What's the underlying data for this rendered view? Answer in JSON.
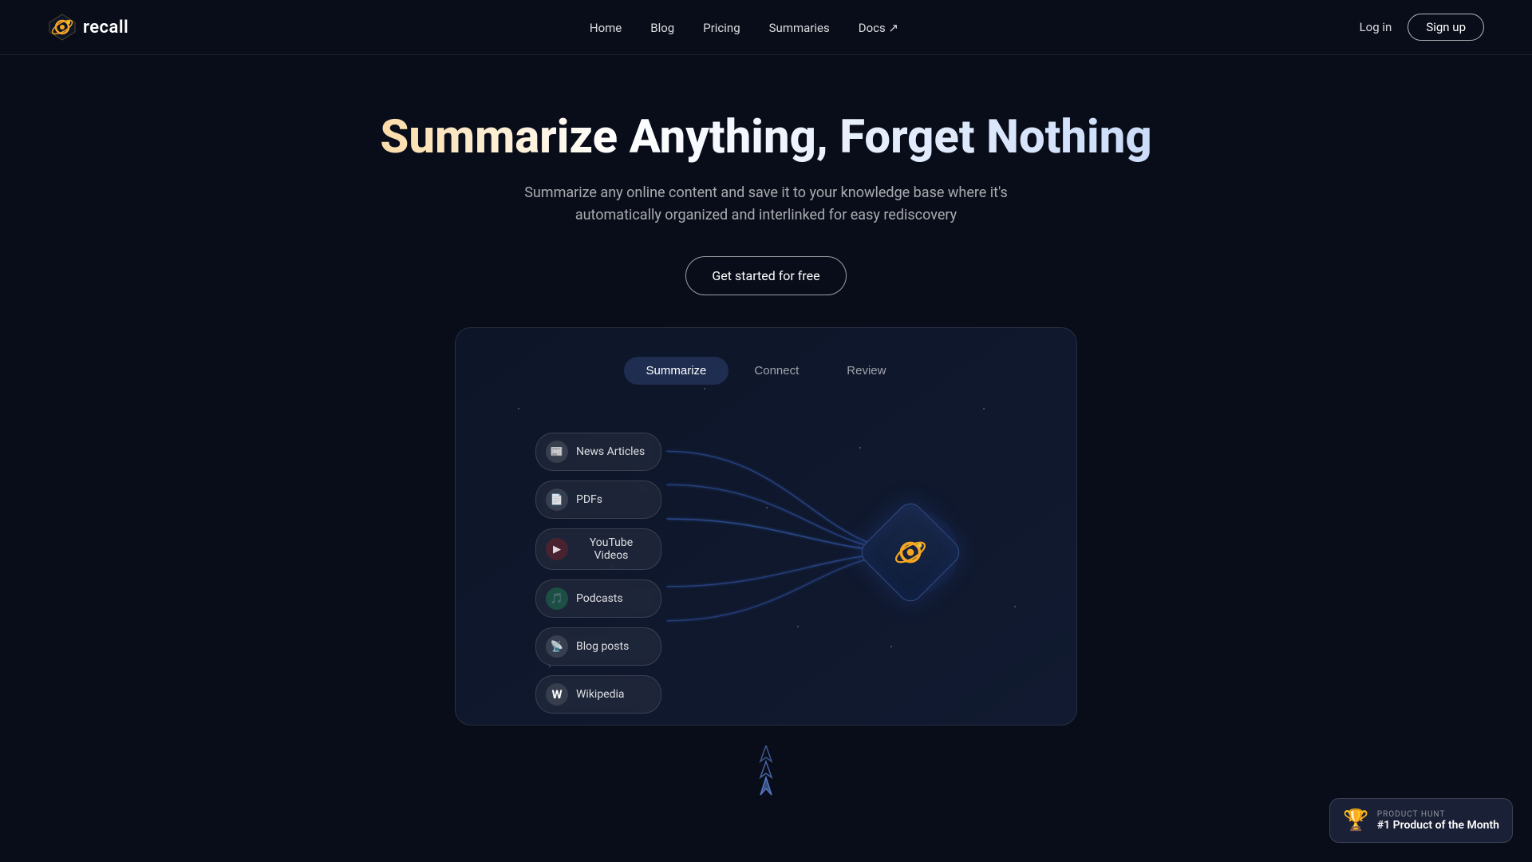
{
  "brand": {
    "name": "recall",
    "logo_alt": "Recall logo"
  },
  "nav": {
    "links": [
      {
        "label": "Home",
        "href": "#"
      },
      {
        "label": "Blog",
        "href": "#"
      },
      {
        "label": "Pricing",
        "href": "#"
      },
      {
        "label": "Summaries",
        "href": "#"
      },
      {
        "label": "Docs ↗",
        "href": "#"
      }
    ],
    "login_label": "Log in",
    "signup_label": "Sign up"
  },
  "hero": {
    "title": "Summarize Anything, Forget Nothing",
    "subtitle": "Summarize any online content and save it to your knowledge base where it's automatically organized and interlinked for easy rediscovery",
    "cta_label": "Get started for free"
  },
  "demo": {
    "tabs": [
      {
        "label": "Summarize",
        "active": true
      },
      {
        "label": "Connect",
        "active": false
      },
      {
        "label": "Review",
        "active": false
      }
    ],
    "sources": [
      {
        "label": "News Articles",
        "icon": "📰"
      },
      {
        "label": "PDFs",
        "icon": "📄"
      },
      {
        "label": "YouTube Videos",
        "icon": "▶"
      },
      {
        "label": "Podcasts",
        "icon": "🎵"
      },
      {
        "label": "Blog posts",
        "icon": "📡"
      },
      {
        "label": "Wikipedia",
        "icon": "W"
      }
    ]
  },
  "product_hunt": {
    "label": "PRODUCT HUNT",
    "title": "#1 Product of the Month"
  },
  "colors": {
    "bg": "#090d1a",
    "accent_blue": "#3a6fd8",
    "line_color": "rgba(80,120,220,0.5)"
  }
}
